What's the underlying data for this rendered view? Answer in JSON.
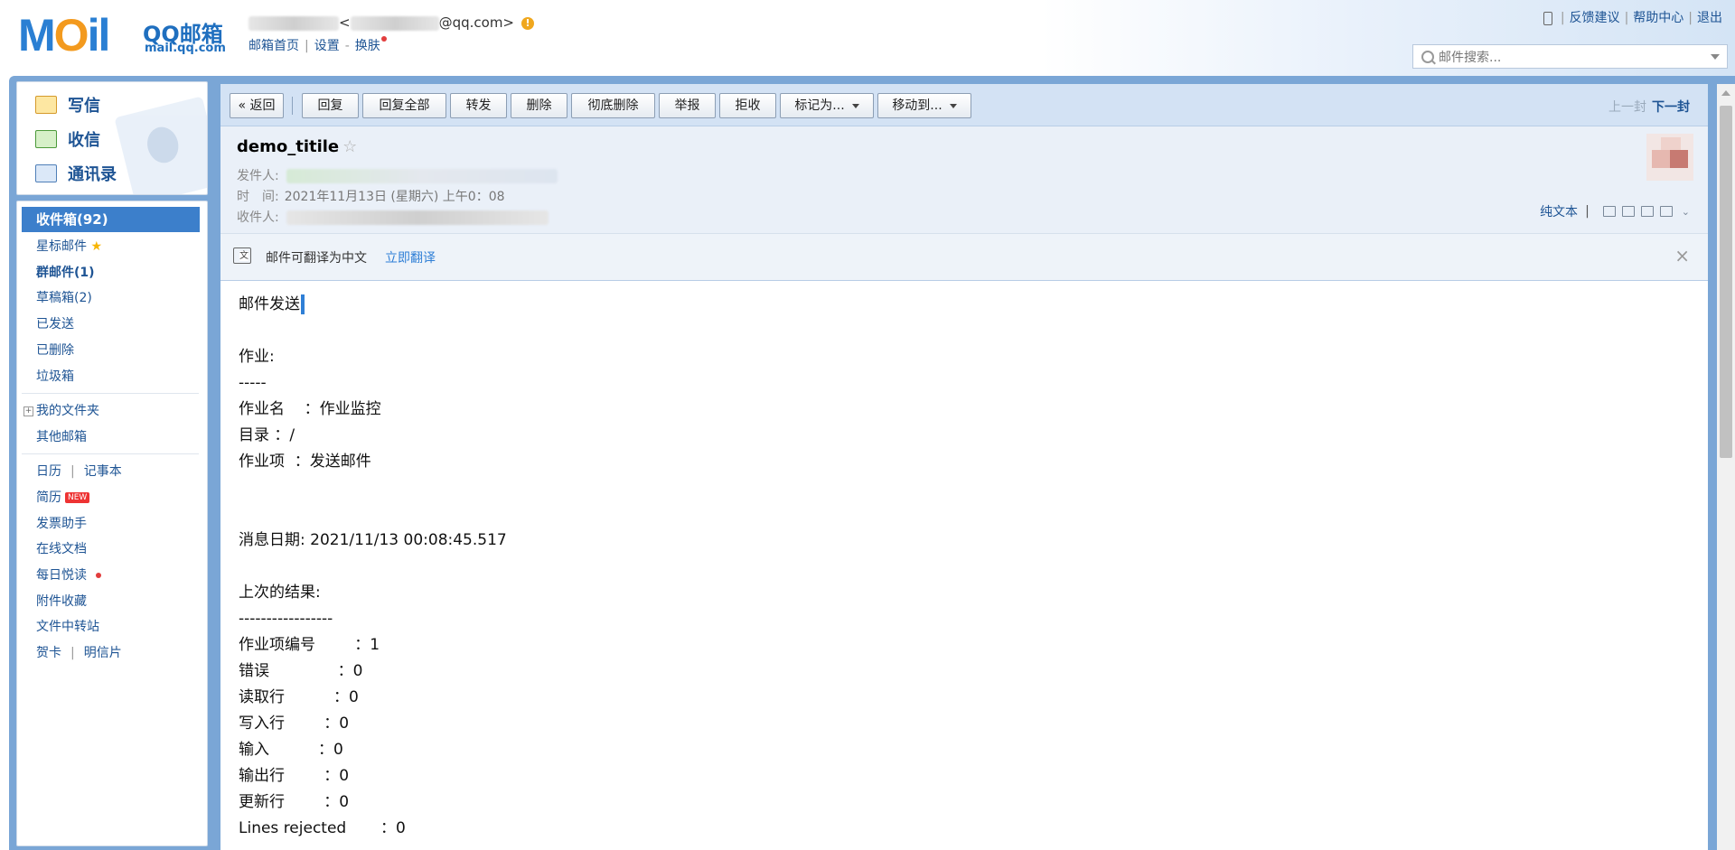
{
  "header": {
    "logo_text": "MOil",
    "logo_brand": "QQ邮箱",
    "logo_domain": "mail.qq.com",
    "user_email_suffix": "@qq.com>",
    "user_email_prefix": "<",
    "links": {
      "home": "邮箱首页",
      "settings": "设置",
      "dash": "-",
      "skin": "换肤"
    },
    "right_links": {
      "feedback": "反馈建议",
      "help": "帮助中心",
      "logout": "退出"
    },
    "search_placeholder": "邮件搜索..."
  },
  "sidebar": {
    "compose": "写信",
    "receive": "收信",
    "contacts": "通讯录",
    "inbox": "收件箱(92)",
    "starred": "星标邮件",
    "group": "群邮件(1)",
    "drafts": "草稿箱(2)",
    "sent": "已发送",
    "deleted": "已删除",
    "trash": "垃圾箱",
    "my_folders": "我的文件夹",
    "other_mailbox": "其他邮箱",
    "calendar": "日历",
    "notepad": "记事本",
    "resume": "简历",
    "new_badge": "NEW",
    "invoice": "发票助手",
    "docs": "在线文档",
    "daily_read": "每日悦读",
    "attachments": "附件收藏",
    "transfer": "文件中转站",
    "card": "贺卡",
    "postcard": "明信片"
  },
  "toolbar": {
    "back": "« 返回",
    "reply": "回复",
    "reply_all": "回复全部",
    "forward": "转发",
    "delete": "删除",
    "perm_delete": "彻底删除",
    "report": "举报",
    "reject": "拒收",
    "mark_as": "标记为...",
    "move_to": "移动到...",
    "prev": "上一封",
    "next": "下一封"
  },
  "mail": {
    "subject": "demo_titile",
    "sender_label": "发件人:",
    "time_label": "时　间:",
    "time_value": "2021年11月13日 (星期六) 上午0：08",
    "recipient_label": "收件人:",
    "plain_text": "纯文本",
    "translate_notice": "邮件可翻译为中文",
    "translate_action": "立即翻译",
    "body_lines": [
      "邮件发送",
      "",
      "作业:",
      "-----",
      "作业名    ：作业监控",
      "目录 ：/",
      "作业项  ：发送邮件",
      "",
      "",
      "消息日期: 2021/11/13 00:08:45.517",
      "",
      "上次的结果:",
      "-----------------",
      "作业项编号        ：1",
      "错误              ：0",
      "读取行          ：0",
      "写入行        ：0",
      "输入          ：0",
      "输出行        ：0",
      "更新行        ：0",
      "Lines rejected       ：0"
    ]
  }
}
